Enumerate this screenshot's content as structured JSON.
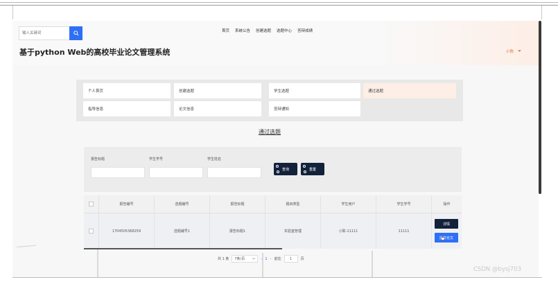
{
  "search": {
    "placeholder": "输入关键词"
  },
  "nav": {
    "items": [
      "首页",
      "系统公告",
      "创建选题",
      "选题中心",
      "答辩成绩"
    ]
  },
  "site": {
    "title": "基于python Web的高校毕业论文管理系统"
  },
  "user": {
    "name": "小陈"
  },
  "menu": {
    "items": [
      "个人首页",
      "创建选题",
      "学生选题",
      "通过选题",
      "指导信息",
      "论文信息",
      "答辩通知"
    ],
    "active_index": 3
  },
  "page": {
    "heading": "通过选题"
  },
  "filter": {
    "labels": [
      "报告标题",
      "学生学号",
      "学生姓名"
    ],
    "search_button": "查询",
    "reset_button": "重置"
  },
  "table": {
    "columns": [
      "报告编号",
      "选题编号",
      "报告标题",
      "题目类型",
      "学生用户",
      "学生学号",
      "操作"
    ],
    "rows": [
      {
        "report_no": "1704505368259",
        "topic_no": "选题编号1",
        "report_title": "报告标题1",
        "topic_type": "实验室管理",
        "student_user": "小陈-11111",
        "student_id": "11111"
      }
    ],
    "row_actions": [
      "详情",
      "提交论文"
    ]
  },
  "pager": {
    "total": "共 1 条",
    "page_size": "7条/页",
    "current": "1",
    "goto_label": "前往",
    "goto_value": "1",
    "page_unit": "页",
    "prev": "‹",
    "next": "›"
  },
  "watermark": "CSDN @bysj703",
  "colors": {
    "accent": "#2f6ff5",
    "dark_button": "#13213a",
    "active_menu": "#fdeee6",
    "user_link": "#e3733a"
  }
}
